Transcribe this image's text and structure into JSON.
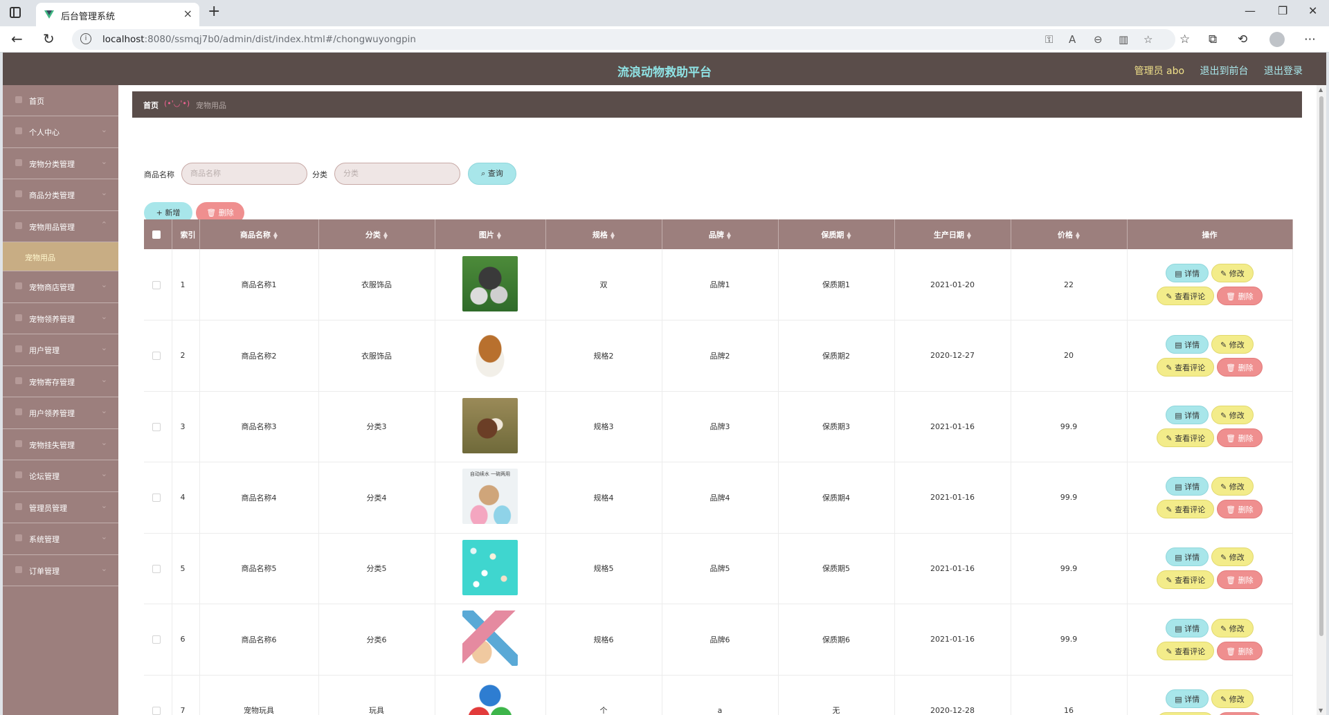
{
  "browser": {
    "tab_title": "后台管理系统",
    "url_host": "localhost",
    "url_rest": ":8080/ssmqj7b0/admin/dist/index.html#/chongwuyongpin",
    "new_tab": "+",
    "close": "×"
  },
  "header": {
    "title": "流浪动物救助平台",
    "user_label": "管理员 abo",
    "front_link": "退出到前台",
    "logout_link": "退出登录"
  },
  "sidebar": {
    "items": [
      {
        "label": "首页"
      },
      {
        "label": "个人中心"
      },
      {
        "label": "宠物分类管理"
      },
      {
        "label": "商品分类管理"
      },
      {
        "label": "宠物用品管理"
      },
      {
        "label": "宠物商店管理"
      },
      {
        "label": "宠物领养管理"
      },
      {
        "label": "用户管理"
      },
      {
        "label": "宠物寄存管理"
      },
      {
        "label": "用户领养管理"
      },
      {
        "label": "宠物挂失管理"
      },
      {
        "label": "论坛管理"
      },
      {
        "label": "管理员管理"
      },
      {
        "label": "系统管理"
      },
      {
        "label": "订单管理"
      }
    ],
    "active_sub": "宠物用品"
  },
  "breadcrumb": {
    "home": "首页",
    "separator": "(•'◡'•)",
    "current": "宠物用品"
  },
  "search": {
    "name_label": "商品名称",
    "name_placeholder": "商品名称",
    "category_label": "分类",
    "category_placeholder": "分类",
    "query_button": "查询"
  },
  "actions": {
    "add_button": "新增",
    "delete_button": "删除"
  },
  "table": {
    "columns": [
      "索引",
      "商品名称",
      "分类",
      "图片",
      "规格",
      "品牌",
      "保质期",
      "生产日期",
      "价格",
      "操作"
    ],
    "rows": [
      {
        "index": "1",
        "name": "商品名称1",
        "category": "衣服饰品",
        "spec": "双",
        "brand": "品牌1",
        "shelf_life": "保质期1",
        "date": "2021-01-20",
        "price": "22"
      },
      {
        "index": "2",
        "name": "商品名称2",
        "category": "衣服饰品",
        "spec": "规格2",
        "brand": "品牌2",
        "shelf_life": "保质期2",
        "date": "2020-12-27",
        "price": "20"
      },
      {
        "index": "3",
        "name": "商品名称3",
        "category": "分类3",
        "spec": "规格3",
        "brand": "品牌3",
        "shelf_life": "保质期3",
        "date": "2021-01-16",
        "price": "99.9"
      },
      {
        "index": "4",
        "name": "商品名称4",
        "category": "分类4",
        "spec": "规格4",
        "brand": "品牌4",
        "shelf_life": "保质期4",
        "date": "2021-01-16",
        "price": "99.9"
      },
      {
        "index": "5",
        "name": "商品名称5",
        "category": "分类5",
        "spec": "规格5",
        "brand": "品牌5",
        "shelf_life": "保质期5",
        "date": "2021-01-16",
        "price": "99.9"
      },
      {
        "index": "6",
        "name": "商品名称6",
        "category": "分类6",
        "spec": "规格6",
        "brand": "品牌6",
        "shelf_life": "保质期6",
        "date": "2021-01-16",
        "price": "99.9"
      },
      {
        "index": "7",
        "name": "宠物玩具",
        "category": "玩具",
        "spec": "个",
        "brand": "a",
        "shelf_life": "无",
        "date": "2020-12-28",
        "price": "16"
      }
    ],
    "image_caption_4": "自动续水 一碗两用",
    "op_labels": {
      "detail": "详情",
      "edit": "修改",
      "comment": "查看评论",
      "delete": "删除"
    }
  },
  "colors": {
    "header_bg": "#5a4d4a",
    "title_color": "#8fe3e5",
    "sidebar_bg": "#9c7f7d",
    "active_sub_bg": "#c8ad84",
    "table_header_bg": "#9c7f7d",
    "btn_cyan": "#a8e6ea",
    "btn_yellow": "#f3ec8a",
    "btn_red": "#ef8f8f"
  }
}
